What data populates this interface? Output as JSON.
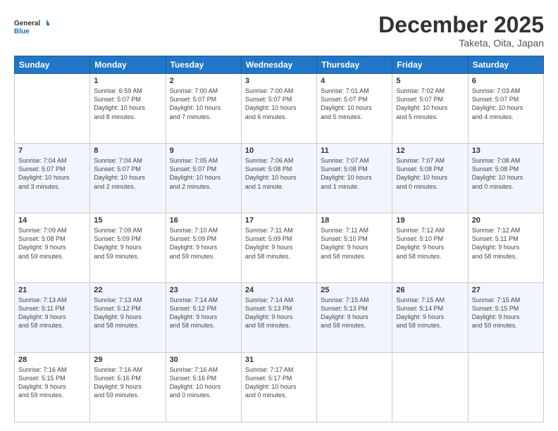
{
  "logo": {
    "line1": "General",
    "line2": "Blue"
  },
  "title": "December 2025",
  "location": "Taketa, Oita, Japan",
  "header_days": [
    "Sunday",
    "Monday",
    "Tuesday",
    "Wednesday",
    "Thursday",
    "Friday",
    "Saturday"
  ],
  "weeks": [
    [
      {
        "day": "",
        "info": ""
      },
      {
        "day": "1",
        "info": "Sunrise: 6:59 AM\nSunset: 5:07 PM\nDaylight: 10 hours\nand 8 minutes."
      },
      {
        "day": "2",
        "info": "Sunrise: 7:00 AM\nSunset: 5:07 PM\nDaylight: 10 hours\nand 7 minutes."
      },
      {
        "day": "3",
        "info": "Sunrise: 7:00 AM\nSunset: 5:07 PM\nDaylight: 10 hours\nand 6 minutes."
      },
      {
        "day": "4",
        "info": "Sunrise: 7:01 AM\nSunset: 5:07 PM\nDaylight: 10 hours\nand 5 minutes."
      },
      {
        "day": "5",
        "info": "Sunrise: 7:02 AM\nSunset: 5:07 PM\nDaylight: 10 hours\nand 5 minutes."
      },
      {
        "day": "6",
        "info": "Sunrise: 7:03 AM\nSunset: 5:07 PM\nDaylight: 10 hours\nand 4 minutes."
      }
    ],
    [
      {
        "day": "7",
        "info": "Sunrise: 7:04 AM\nSunset: 5:07 PM\nDaylight: 10 hours\nand 3 minutes."
      },
      {
        "day": "8",
        "info": "Sunrise: 7:04 AM\nSunset: 5:07 PM\nDaylight: 10 hours\nand 2 minutes."
      },
      {
        "day": "9",
        "info": "Sunrise: 7:05 AM\nSunset: 5:07 PM\nDaylight: 10 hours\nand 2 minutes."
      },
      {
        "day": "10",
        "info": "Sunrise: 7:06 AM\nSunset: 5:08 PM\nDaylight: 10 hours\nand 1 minute."
      },
      {
        "day": "11",
        "info": "Sunrise: 7:07 AM\nSunset: 5:08 PM\nDaylight: 10 hours\nand 1 minute."
      },
      {
        "day": "12",
        "info": "Sunrise: 7:07 AM\nSunset: 5:08 PM\nDaylight: 10 hours\nand 0 minutes."
      },
      {
        "day": "13",
        "info": "Sunrise: 7:08 AM\nSunset: 5:08 PM\nDaylight: 10 hours\nand 0 minutes."
      }
    ],
    [
      {
        "day": "14",
        "info": "Sunrise: 7:09 AM\nSunset: 5:08 PM\nDaylight: 9 hours\nand 59 minutes."
      },
      {
        "day": "15",
        "info": "Sunrise: 7:09 AM\nSunset: 5:09 PM\nDaylight: 9 hours\nand 59 minutes."
      },
      {
        "day": "16",
        "info": "Sunrise: 7:10 AM\nSunset: 5:09 PM\nDaylight: 9 hours\nand 59 minutes."
      },
      {
        "day": "17",
        "info": "Sunrise: 7:11 AM\nSunset: 5:09 PM\nDaylight: 9 hours\nand 58 minutes."
      },
      {
        "day": "18",
        "info": "Sunrise: 7:11 AM\nSunset: 5:10 PM\nDaylight: 9 hours\nand 58 minutes."
      },
      {
        "day": "19",
        "info": "Sunrise: 7:12 AM\nSunset: 5:10 PM\nDaylight: 9 hours\nand 58 minutes."
      },
      {
        "day": "20",
        "info": "Sunrise: 7:12 AM\nSunset: 5:11 PM\nDaylight: 9 hours\nand 58 minutes."
      }
    ],
    [
      {
        "day": "21",
        "info": "Sunrise: 7:13 AM\nSunset: 5:11 PM\nDaylight: 9 hours\nand 58 minutes."
      },
      {
        "day": "22",
        "info": "Sunrise: 7:13 AM\nSunset: 5:12 PM\nDaylight: 9 hours\nand 58 minutes."
      },
      {
        "day": "23",
        "info": "Sunrise: 7:14 AM\nSunset: 5:12 PM\nDaylight: 9 hours\nand 58 minutes."
      },
      {
        "day": "24",
        "info": "Sunrise: 7:14 AM\nSunset: 5:13 PM\nDaylight: 9 hours\nand 58 minutes."
      },
      {
        "day": "25",
        "info": "Sunrise: 7:15 AM\nSunset: 5:13 PM\nDaylight: 9 hours\nand 58 minutes."
      },
      {
        "day": "26",
        "info": "Sunrise: 7:15 AM\nSunset: 5:14 PM\nDaylight: 9 hours\nand 58 minutes."
      },
      {
        "day": "27",
        "info": "Sunrise: 7:15 AM\nSunset: 5:15 PM\nDaylight: 9 hours\nand 59 minutes."
      }
    ],
    [
      {
        "day": "28",
        "info": "Sunrise: 7:16 AM\nSunset: 5:15 PM\nDaylight: 9 hours\nand 59 minutes."
      },
      {
        "day": "29",
        "info": "Sunrise: 7:16 AM\nSunset: 5:16 PM\nDaylight: 9 hours\nand 59 minutes."
      },
      {
        "day": "30",
        "info": "Sunrise: 7:16 AM\nSunset: 5:16 PM\nDaylight: 10 hours\nand 0 minutes."
      },
      {
        "day": "31",
        "info": "Sunrise: 7:17 AM\nSunset: 5:17 PM\nDaylight: 10 hours\nand 0 minutes."
      },
      {
        "day": "",
        "info": ""
      },
      {
        "day": "",
        "info": ""
      },
      {
        "day": "",
        "info": ""
      }
    ]
  ]
}
